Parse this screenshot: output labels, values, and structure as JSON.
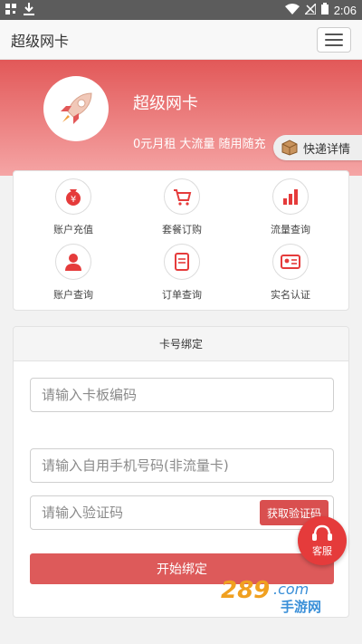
{
  "status_bar": {
    "time": "2:06"
  },
  "app_bar": {
    "title": "超级网卡"
  },
  "hero": {
    "name": "超级网卡",
    "tagline": "0元月租 大流量 随用随充",
    "express_button": "快递详情"
  },
  "grid": {
    "items": [
      {
        "label": "账户充值",
        "icon": "money-bag-icon"
      },
      {
        "label": "套餐订购",
        "icon": "cart-icon"
      },
      {
        "label": "流量查询",
        "icon": "bar-chart-icon"
      },
      {
        "label": "账户查询",
        "icon": "user-icon"
      },
      {
        "label": "订单查询",
        "icon": "document-icon"
      },
      {
        "label": "实名认证",
        "icon": "id-card-icon"
      }
    ]
  },
  "bind": {
    "header": "卡号绑定",
    "card_number_placeholder": "请输入卡板编码",
    "phone_placeholder": "请输入自用手机号码(非流量卡)",
    "code_placeholder": "请输入验证码",
    "get_code_button": "获取验证码",
    "submit_button": "开始绑定"
  },
  "service": {
    "label": "客服"
  },
  "watermark": {
    "text": "289.com",
    "subtext": "手游网"
  },
  "colors": {
    "brand": "#e25858",
    "accent": "#d94f4f"
  }
}
